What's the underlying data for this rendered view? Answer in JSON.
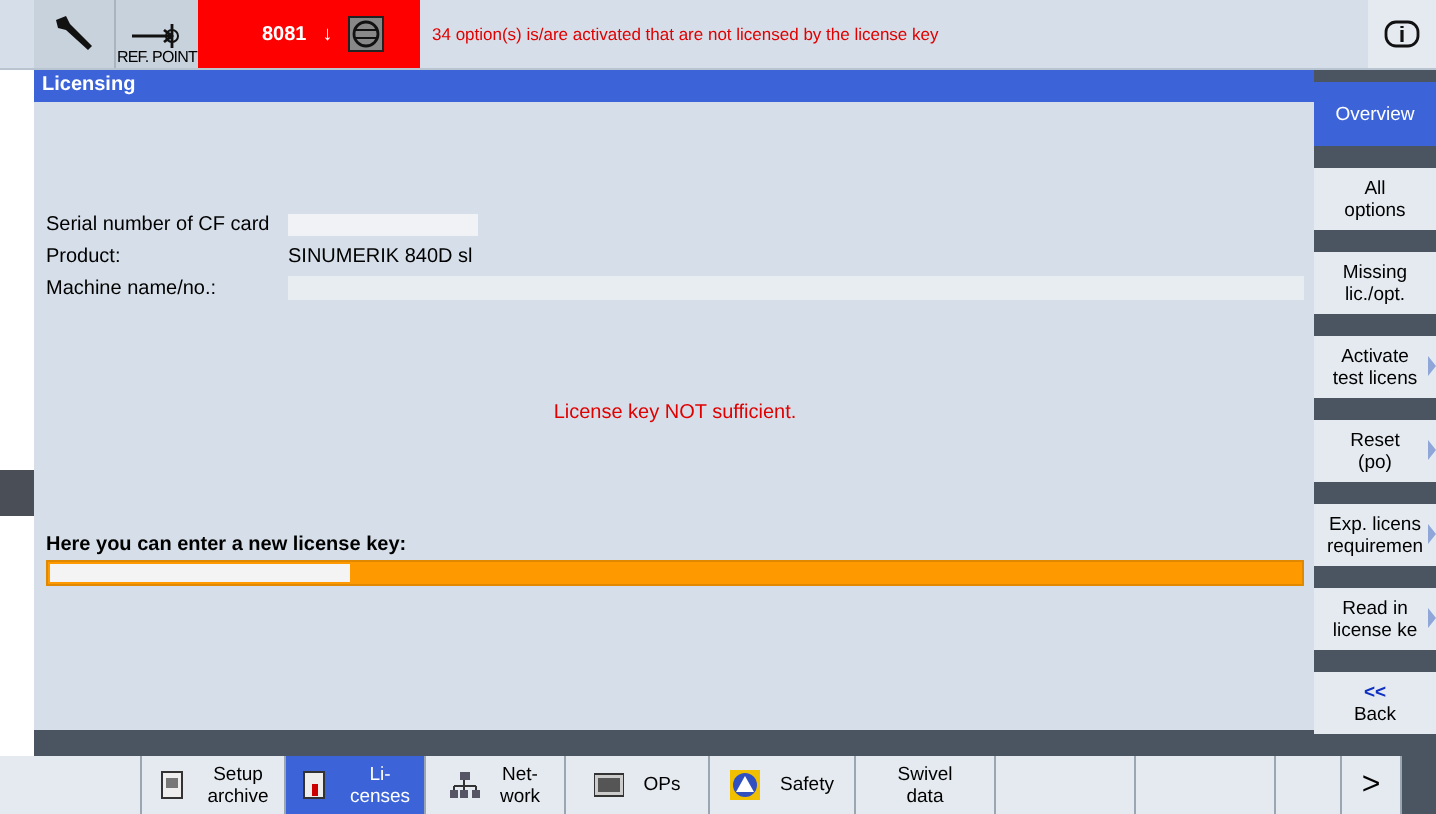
{
  "header": {
    "ref_point_label": "REF. POINT",
    "alarm_number": "8081",
    "alarm_arrow": "↓",
    "alarm_message": "34 option(s) is/are activated that are not licensed by the license key"
  },
  "panel": {
    "title": "Licensing",
    "fields": [
      {
        "kind": "redacted",
        "label": "Serial number of CF card"
      },
      {
        "kind": "text",
        "label": "Product:",
        "value": "SINUMERIK 840D sl"
      },
      {
        "kind": "empty",
        "label": "Machine name/no.:"
      }
    ],
    "status_message": "License key NOT sufficient.",
    "key_prompt": "Here you can enter a new license key:"
  },
  "vertical_softkeys": [
    {
      "lines": [
        "Overview"
      ],
      "selected": true,
      "arrow": false
    },
    {
      "lines": [
        "All",
        "options"
      ],
      "selected": false,
      "arrow": false
    },
    {
      "lines": [
        "Missing",
        "lic./opt."
      ],
      "selected": false,
      "arrow": false
    },
    {
      "lines": [
        "Activate",
        "test licens"
      ],
      "selected": false,
      "arrow": true
    },
    {
      "lines": [
        "Reset",
        "(po)"
      ],
      "selected": false,
      "arrow": true
    },
    {
      "lines": [
        "Exp. licens",
        "requiremen"
      ],
      "selected": false,
      "arrow": true
    },
    {
      "lines": [
        "Read in",
        "license ke"
      ],
      "selected": false,
      "arrow": true
    },
    {
      "lines": [
        "<<",
        "Back"
      ],
      "selected": false,
      "arrow": false
    }
  ],
  "horizontal_softkeys": [
    {
      "kind": "empty",
      "selected": false
    },
    {
      "kind": "archive",
      "lines": [
        "Setup",
        "archive"
      ],
      "selected": false
    },
    {
      "kind": "licenses",
      "lines": [
        "Li-",
        "censes"
      ],
      "selected": true
    },
    {
      "kind": "network",
      "lines": [
        "Net-",
        "work"
      ],
      "selected": false
    },
    {
      "kind": "ops",
      "lines": [
        "OPs"
      ],
      "selected": false
    },
    {
      "kind": "safety",
      "lines": [
        "Safety"
      ],
      "selected": false
    },
    {
      "kind": "text",
      "lines": [
        "Swivel",
        "data"
      ],
      "selected": false
    },
    {
      "kind": "empty",
      "selected": false
    },
    {
      "kind": "empty",
      "selected": false
    },
    {
      "kind": "empty",
      "selected": false
    },
    {
      "kind": "next",
      "lines": [
        ">"
      ],
      "selected": false
    }
  ]
}
